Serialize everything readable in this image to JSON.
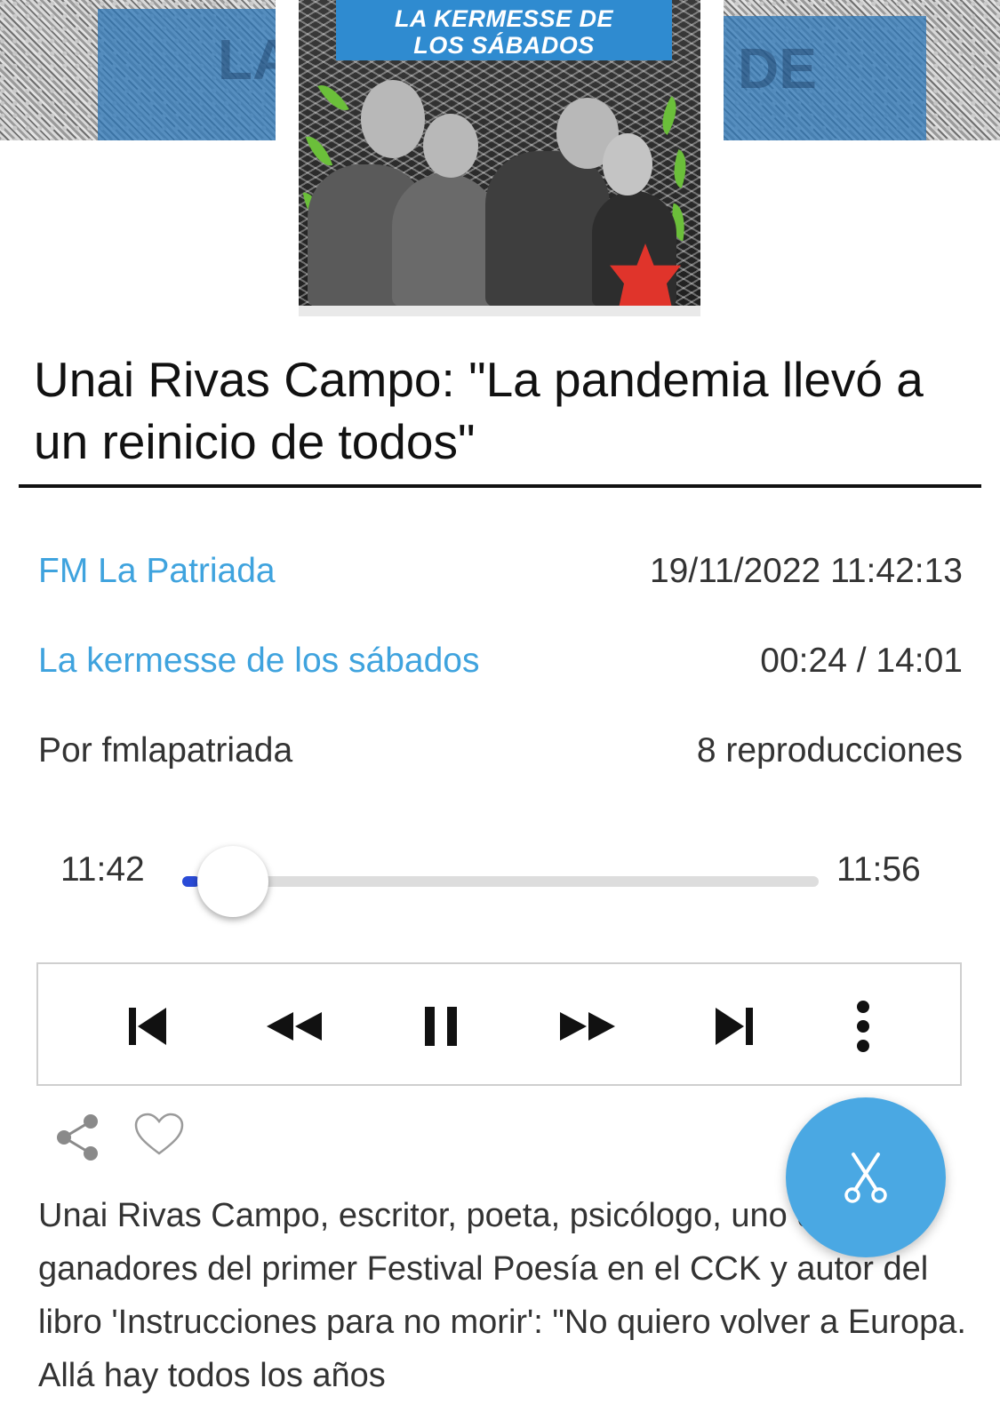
{
  "cover": {
    "title_line1": "LA KERMESSE DE",
    "title_line2": "LOS SÁBADOS",
    "bg_left_text": "LA",
    "bg_right_text": "DE"
  },
  "article": {
    "headline": "Unai Rivas Campo: \"La pandemia llevó a un reinicio de todos\"",
    "station": "FM La Patriada",
    "datetime": "19/11/2022 11:42:13",
    "program": "La kermesse de los sábados",
    "playback_time": "00:24 / 14:01",
    "author": "Por fmlapatriada",
    "plays": "8 reproducciones",
    "description": "Unai Rivas Campo, escritor, poeta, psicólogo, uno de los ganadores del primer Festival Poesía en el CCK y autor del libro 'Instrucciones para no morir': \"No quiero volver a Europa. Allá hay todos los años"
  },
  "player": {
    "start_time": "11:42",
    "end_time": "11:56",
    "progress_fraction": 0.0285,
    "buttons": [
      "skip-previous-icon",
      "rewind-icon",
      "pause-icon",
      "fast-forward-icon",
      "skip-next-icon",
      "more-vertical-icon"
    ]
  },
  "actions": {
    "share_icon": "share-icon",
    "like_icon": "heart-outline-icon",
    "fab_icon": "scissors-icon"
  },
  "colors": {
    "link": "#3fa3de",
    "progress": "#2a4bd7",
    "fab": "#4aa8e3"
  }
}
